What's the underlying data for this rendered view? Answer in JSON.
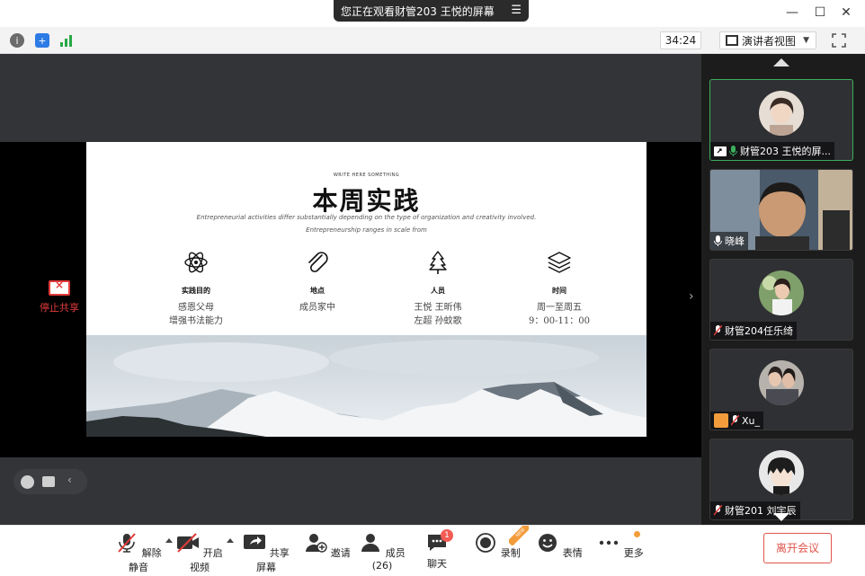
{
  "titlebar": {
    "share_banner": "您正在观看财管203  王悦的屏幕",
    "menu_glyph": "☰",
    "minimize": "—",
    "maximize": "☐",
    "close": "✕"
  },
  "infobar": {
    "timer": "34:24",
    "view_mode": "演讲者视图",
    "view_arrow": "▼"
  },
  "stage": {
    "stop_share_label": "停止共享",
    "next_arrow": "›"
  },
  "slide": {
    "kicker": "WRITE HERE SOMETHING",
    "title": "本周实践",
    "subtitle_1": "Entrepreneurial activities differ substantially depending on the type of organization and creativity involved.",
    "subtitle_2": "Entrepreneurship ranges in scale from",
    "columns": [
      {
        "head": "实践目的",
        "line1": "感恩父母",
        "line2": "增强书法能力",
        "icon": "atom-icon"
      },
      {
        "head": "地点",
        "line1": "成员家中",
        "line2": "",
        "icon": "paperclip-icon"
      },
      {
        "head": "人员",
        "line1": "王悦  王昕伟",
        "line2": "左超  孙蚊歌",
        "icon": "tree-icon"
      },
      {
        "head": "时间",
        "line1": "周一至周五",
        "line2": "9：00-11：00",
        "icon": "layers-icon"
      }
    ]
  },
  "chat_strip": {
    "collapse": "‹"
  },
  "gallery": {
    "tiles": [
      {
        "name": "财管203  王悦的屏...",
        "muted": false
      },
      {
        "name": "晓峰",
        "muted": false
      },
      {
        "name": "财管204任乐绮",
        "muted": true
      },
      {
        "name": "Xu_",
        "muted": true
      },
      {
        "name": "财管201  刘宇辰",
        "muted": true
      }
    ]
  },
  "toolbar": {
    "unmute": "解除静音",
    "start_video": "开启视频",
    "share_screen": "共享屏幕",
    "invite": "邀请",
    "members": "成员(26)",
    "chat": "聊天",
    "chat_badge": "1",
    "record": "录制",
    "record_tag": "NEW",
    "reactions": "表情",
    "more": "更多",
    "leave": "离开会议"
  },
  "colors": {
    "accent_green": "#3cae5c",
    "leave_red": "#e0554b",
    "stop_share_red": "#e23b3b",
    "badge_red": "#f25c54",
    "notify_orange": "#f39c3b"
  }
}
